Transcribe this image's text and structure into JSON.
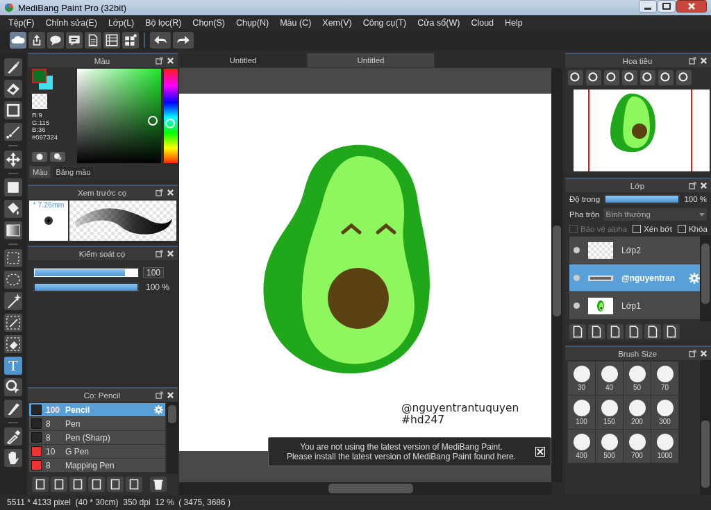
{
  "window": {
    "title": "MediBang Paint Pro (32bit)"
  },
  "menu": [
    "Tệp(F)",
    "Chỉnh sửa(E)",
    "Lớp(L)",
    "Bộ lọc(R)",
    "Chọn(S)",
    "Chụp(N)",
    "Màu (C)",
    "Xem(V)",
    "Công cụ(T)",
    "Cửa sổ(W)",
    "Cloud",
    "Help"
  ],
  "tools": [
    {
      "kind": "brush",
      "selected": false,
      "gap_before": false
    },
    {
      "kind": "eraser",
      "selected": false,
      "gap_before": false
    },
    {
      "kind": "square",
      "selected": false,
      "gap_before": false
    },
    {
      "kind": "dot-pen",
      "selected": false,
      "gap_before": false
    },
    {
      "kind": "move",
      "selected": false,
      "gap_before": true
    },
    {
      "kind": "fill",
      "selected": false,
      "gap_before": true
    },
    {
      "kind": "bucket",
      "selected": false,
      "gap_before": false
    },
    {
      "kind": "gradient",
      "selected": false,
      "gap_before": false
    },
    {
      "kind": "select",
      "selected": false,
      "gap_before": true
    },
    {
      "kind": "lasso",
      "selected": false,
      "gap_before": false
    },
    {
      "kind": "wand",
      "selected": false,
      "gap_before": false
    },
    {
      "kind": "select-pen",
      "selected": false,
      "gap_before": false
    },
    {
      "kind": "select-eraser",
      "selected": false,
      "gap_before": false
    },
    {
      "kind": "text",
      "label": "T",
      "selected": true,
      "gap_before": false
    },
    {
      "kind": "pointer",
      "selected": false,
      "gap_before": false
    },
    {
      "kind": "knife",
      "selected": false,
      "gap_before": false
    },
    {
      "kind": "dropper",
      "selected": false,
      "gap_before": true
    },
    {
      "kind": "hand",
      "selected": false,
      "gap_before": false
    }
  ],
  "color_panel": {
    "title": "Màu",
    "readout": [
      "R:9",
      "G:115",
      "B:36",
      "#097324"
    ],
    "tabs": [
      {
        "label": "Màu",
        "selected": true
      },
      {
        "label": "Bảng màu",
        "selected": false
      }
    ]
  },
  "brush_preview": {
    "title": "Xem trước cọ",
    "size": "* 7.26mm"
  },
  "brush_control": {
    "title": "Kiểm soát cọ",
    "sliders": [
      {
        "level": 0.88,
        "reading": "100"
      },
      {
        "level": 1,
        "reading": "100 %"
      }
    ]
  },
  "brush_list": {
    "title": "Cọ: Pencil",
    "items": [
      {
        "color": "#262626",
        "size": "100",
        "name": "Pencil",
        "selected": true
      },
      {
        "color": "#262626",
        "size": "8",
        "name": "Pen",
        "selected": false
      },
      {
        "color": "#262626",
        "size": "8",
        "name": "Pen (Sharp)",
        "selected": false
      },
      {
        "color": "#f03434",
        "size": "10",
        "name": "G Pen",
        "selected": false
      },
      {
        "color": "#f03434",
        "size": "8",
        "name": "Mapping Pen",
        "selected": false
      }
    ]
  },
  "doc_tabs": [
    {
      "label": "Untitled",
      "selected": false
    },
    {
      "label": "Untitled",
      "selected": true
    }
  ],
  "canvas": {
    "signature": [
      "@nguyentrantuquyen",
      "#hd247"
    ]
  },
  "notice": {
    "lines": [
      "You are not using the latest version of MediBang Paint.",
      "Please install the latest version of MediBang Paint found here."
    ]
  },
  "navigator": {
    "title": "Hoa tiêu"
  },
  "layers": {
    "title": "Lớp",
    "opacity_label": "Độ trong",
    "opacity": {
      "level": 1,
      "reading": "100 %"
    },
    "blend_label": "Pha trộn",
    "blend": "Bình thường",
    "options": [
      {
        "label": "Bảo vệ alpha",
        "checked": false,
        "disabled": true
      },
      {
        "label": "Xén bớt",
        "checked": false,
        "disabled": false
      },
      {
        "label": "Khóa",
        "checked": false,
        "disabled": false
      }
    ],
    "items": [
      {
        "name": "Lớp2",
        "kind": "empty",
        "selected": false
      },
      {
        "name": "@nguyentran",
        "kind": "text",
        "selected": true
      },
      {
        "name": "Lớp1",
        "kind": "drawing",
        "selected": false
      }
    ]
  },
  "brush_size": {
    "title": "Brush Size",
    "sizes": [
      "30",
      "40",
      "50",
      "70",
      "100",
      "150",
      "200",
      "300",
      "400",
      "500",
      "700",
      "1000"
    ]
  },
  "status": "5511 * 4133 pixel  (40 * 30cm)  350 dpi  12 %  ( 3475, 3686 )"
}
